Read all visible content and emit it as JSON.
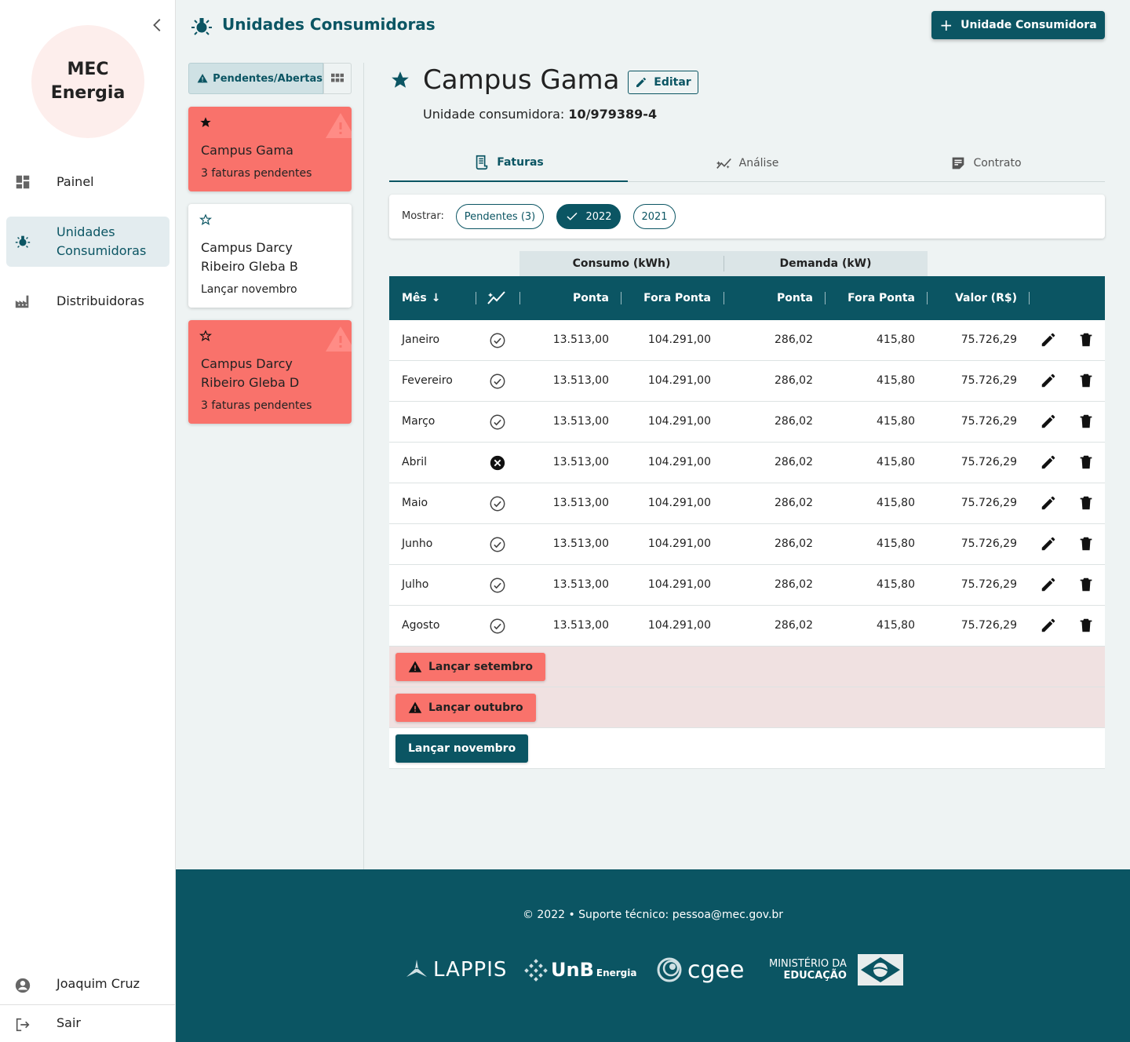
{
  "sidebar": {
    "logo_line1": "MEC",
    "logo_line2": "Energia",
    "nav": [
      {
        "label": "Painel",
        "icon": "dashboard-icon"
      },
      {
        "label": "Unidades Consumidoras",
        "icon": "lightbulb-icon",
        "active": true
      },
      {
        "label": "Distribuidoras",
        "icon": "factory-icon"
      }
    ],
    "user_name": "Joaquim Cruz",
    "logout_label": "Sair"
  },
  "header": {
    "title": "Unidades Consumidoras",
    "new_button_label": "Unidade Consumidora"
  },
  "list": {
    "filter_label": "Pendentes/Abertas",
    "cards": [
      {
        "name": "Campus Gama",
        "subtitle": "3 faturas pendentes",
        "favorite": true,
        "alert": true
      },
      {
        "name": "Campus Darcy Ribeiro Gleba B",
        "subtitle": "Lançar novembro",
        "favorite": false,
        "alert": false
      },
      {
        "name": "Campus Darcy Ribeiro Gleba D",
        "subtitle": "3 faturas pendentes",
        "favorite": false,
        "alert": true
      }
    ]
  },
  "detail": {
    "title": "Campus Gama",
    "edit_label": "Editar",
    "uc_label": "Unidade consumidora:",
    "uc_number": "10/979389-4",
    "tabs": [
      "Faturas",
      "Análise",
      "Contrato"
    ],
    "show_label": "Mostrar:",
    "chips": [
      "Pendentes (3)",
      "2022",
      "2021"
    ],
    "group_consumo": "Consumo (kWh)",
    "group_demanda": "Demanda (kW)",
    "columns": {
      "mes": "Mês",
      "ponta": "Ponta",
      "fora_ponta": "Fora Ponta",
      "valor": "Valor (R$)"
    },
    "rows": [
      {
        "mes": "Janeiro",
        "status": "ok",
        "c_ponta": "13.513,00",
        "c_fora": "104.291,00",
        "d_ponta": "286,02",
        "d_fora": "415,80",
        "valor": "75.726,29"
      },
      {
        "mes": "Fevereiro",
        "status": "ok",
        "c_ponta": "13.513,00",
        "c_fora": "104.291,00",
        "d_ponta": "286,02",
        "d_fora": "415,80",
        "valor": "75.726,29"
      },
      {
        "mes": "Março",
        "status": "ok",
        "c_ponta": "13.513,00",
        "c_fora": "104.291,00",
        "d_ponta": "286,02",
        "d_fora": "415,80",
        "valor": "75.726,29"
      },
      {
        "mes": "Abril",
        "status": "error",
        "c_ponta": "13.513,00",
        "c_fora": "104.291,00",
        "d_ponta": "286,02",
        "d_fora": "415,80",
        "valor": "75.726,29"
      },
      {
        "mes": "Maio",
        "status": "ok",
        "c_ponta": "13.513,00",
        "c_fora": "104.291,00",
        "d_ponta": "286,02",
        "d_fora": "415,80",
        "valor": "75.726,29"
      },
      {
        "mes": "Junho",
        "status": "ok",
        "c_ponta": "13.513,00",
        "c_fora": "104.291,00",
        "d_ponta": "286,02",
        "d_fora": "415,80",
        "valor": "75.726,29"
      },
      {
        "mes": "Julho",
        "status": "ok",
        "c_ponta": "13.513,00",
        "c_fora": "104.291,00",
        "d_ponta": "286,02",
        "d_fora": "415,80",
        "valor": "75.726,29"
      },
      {
        "mes": "Agosto",
        "status": "ok",
        "c_ponta": "13.513,00",
        "c_fora": "104.291,00",
        "d_ponta": "286,02",
        "d_fora": "415,80",
        "valor": "75.726,29"
      }
    ],
    "launch": [
      {
        "label": "Lançar setembro",
        "pending": true
      },
      {
        "label": "Lançar outubro",
        "pending": true
      },
      {
        "label": "Lançar novembro",
        "pending": false
      }
    ]
  },
  "footer": {
    "text": "© 2022  •  Suporte técnico: pessoa@mec.gov.br",
    "logos": {
      "lappis": "LAPPIS",
      "unb": "UnB",
      "unb_sub": "Energia",
      "cgee": "cgee",
      "mec_line1": "MINISTÉRIO DA",
      "mec_line2": "EDUCAÇÃO"
    }
  },
  "colors": {
    "primary": "#0b5563",
    "alert": "#f9726b",
    "pending_row": "#f0e1e1",
    "background": "#eef3f3"
  }
}
